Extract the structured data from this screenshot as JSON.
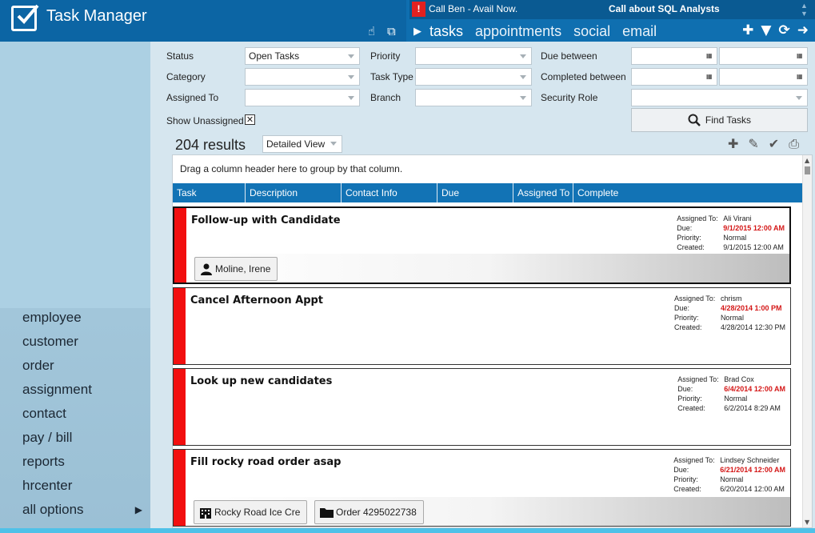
{
  "app": {
    "title": "Task Manager",
    "tool_icons": [
      "pointer-icon",
      "popout-icon"
    ]
  },
  "alerts": {
    "bang": "!",
    "first": "Call Ben - Avail Now.",
    "second": "Call about SQL Analysts"
  },
  "nav": {
    "tabs": [
      "tasks",
      "appointments",
      "social",
      "email"
    ],
    "active": "tasks",
    "actions": [
      "add-icon",
      "filter-icon",
      "refresh-icon",
      "forward-icon"
    ]
  },
  "sidebar": {
    "items": [
      "employee",
      "customer",
      "order",
      "assignment",
      "contact",
      "pay / bill",
      "reports",
      "hrcenter",
      "all options"
    ]
  },
  "filters": {
    "status_label": "Status",
    "status_value": "Open Tasks",
    "category_label": "Category",
    "category_value": "",
    "assigned_to_label": "Assigned To",
    "assigned_to_value": "",
    "show_unassigned_label": "Show Unassigned",
    "show_unassigned_checked": "✕",
    "priority_label": "Priority",
    "priority_value": "",
    "task_type_label": "Task Type",
    "task_type_value": "",
    "branch_label": "Branch",
    "branch_value": "",
    "due_between_label": "Due between",
    "completed_between_label": "Completed between",
    "security_role_label": "Security Role",
    "security_role_value": "",
    "find_button": "Find Tasks"
  },
  "results": {
    "count": "204 results",
    "view": "Detailed View"
  },
  "grid": {
    "group_hint": "Drag a column header here to group by that column.",
    "columns": [
      "Task",
      "Description",
      "Contact Info",
      "Due",
      "Assigned To",
      "Complete"
    ]
  },
  "tasks": [
    {
      "title": "Follow-up with Candidate",
      "assigned_label": "Assigned To:",
      "assigned": "Ali Virani",
      "due_label": "Due:",
      "due": "9/1/2015 12:00 AM",
      "priority_label": "Priority:",
      "priority": "Normal",
      "created_label": "Created:",
      "created": "9/1/2015 12:00 AM",
      "chips": [
        {
          "icon": "person-icon",
          "label": "Moline, Irene"
        }
      ]
    },
    {
      "title": "Cancel Afternoon Appt",
      "assigned_label": "Assigned To:",
      "assigned": "chrism",
      "due_label": "Due:",
      "due": "4/28/2014 1:00 PM",
      "priority_label": "Priority:",
      "priority": "Normal",
      "created_label": "Created:",
      "created": "4/28/2014 12:30 PM",
      "chips": []
    },
    {
      "title": "Look up new candidates",
      "assigned_label": "Assigned To:",
      "assigned": "Brad Cox",
      "due_label": "Due:",
      "due": "6/4/2014 12:00 AM",
      "priority_label": "Priority:",
      "priority": "Normal",
      "created_label": "Created:",
      "created": "6/2/2014 8:29 AM",
      "chips": []
    },
    {
      "title": "Fill rocky road order asap",
      "assigned_label": "Assigned To:",
      "assigned": "Lindsey Schneider",
      "due_label": "Due:",
      "due": "6/21/2014 12:00 AM",
      "priority_label": "Priority:",
      "priority": "Normal",
      "created_label": "Created:",
      "created": "6/20/2014 12:00 AM",
      "chips": [
        {
          "icon": "building-icon",
          "label": "Rocky Road Ice Cre"
        },
        {
          "icon": "folder-icon",
          "label": "Order 4295022738"
        }
      ]
    }
  ],
  "colors": {
    "header": "#0f6fb0",
    "accent": "#1273b5",
    "priority_bar": "#f20f0f",
    "due_text": "#d41616"
  }
}
